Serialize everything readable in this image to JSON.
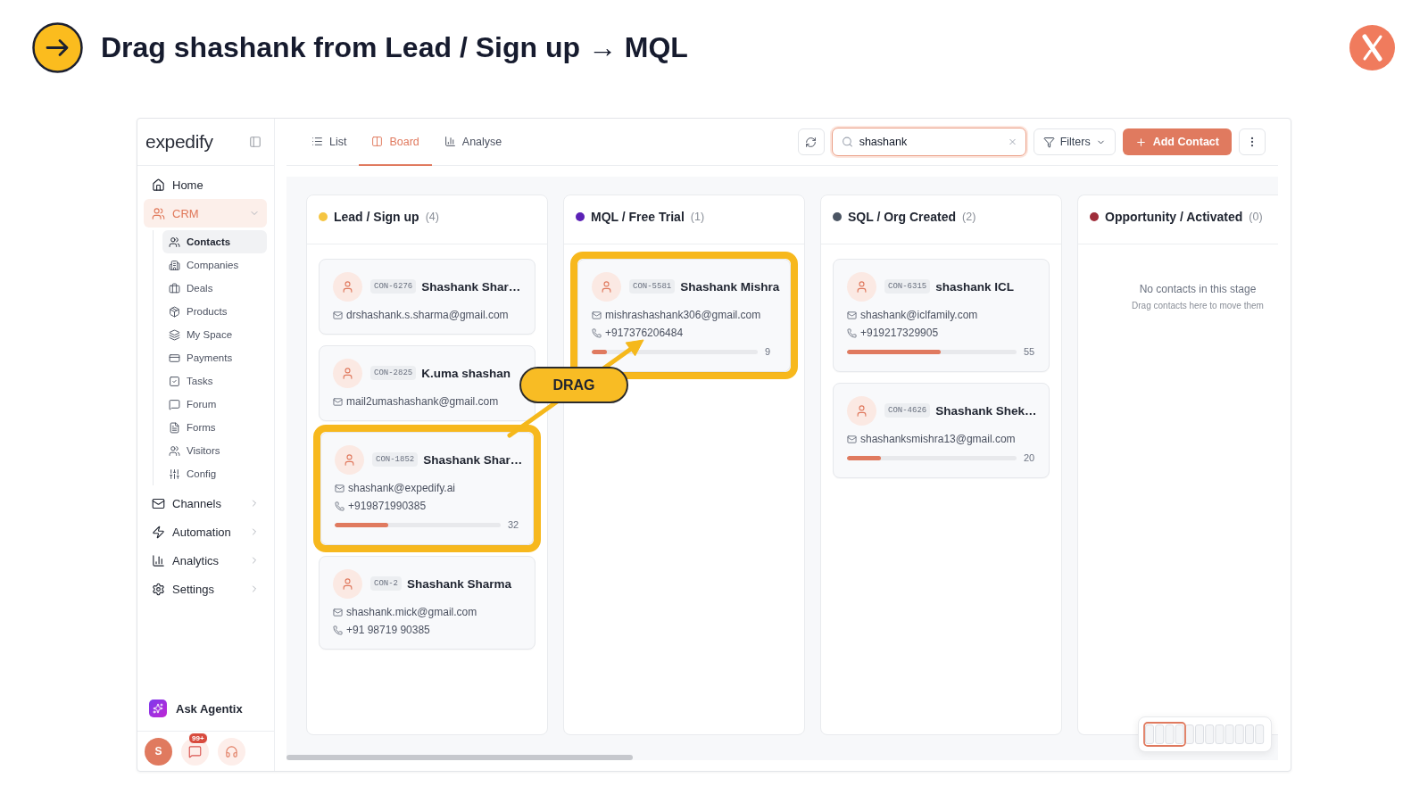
{
  "slide": {
    "title": "Drag shashank from Lead / Sign up → MQL"
  },
  "app": {
    "logo": "expedify",
    "sidebar": {
      "items": [
        {
          "label": "Home",
          "selected": false
        },
        {
          "label": "CRM",
          "selected": true,
          "expanded": true,
          "children": [
            {
              "label": "Contacts",
              "selected": true
            },
            {
              "label": "Companies",
              "selected": false
            },
            {
              "label": "Deals",
              "selected": false
            },
            {
              "label": "Products",
              "selected": false
            },
            {
              "label": "My Space",
              "selected": false
            },
            {
              "label": "Payments",
              "selected": false
            },
            {
              "label": "Tasks",
              "selected": false
            },
            {
              "label": "Forum",
              "selected": false
            },
            {
              "label": "Forms",
              "selected": false
            },
            {
              "label": "Visitors",
              "selected": false
            },
            {
              "label": "Config",
              "selected": false
            }
          ]
        },
        {
          "label": "Channels",
          "selected": false,
          "expanded": false
        },
        {
          "label": "Automation",
          "selected": false,
          "expanded": false
        },
        {
          "label": "Analytics",
          "selected": false,
          "expanded": false
        },
        {
          "label": "Settings",
          "selected": false,
          "expanded": false
        }
      ],
      "assistant": "Ask Agentix",
      "user_initial": "S",
      "notification_count": "99+"
    },
    "view_tabs": [
      {
        "label": "List",
        "selected": false
      },
      {
        "label": "Board",
        "selected": true
      },
      {
        "label": "Analyse",
        "selected": false
      }
    ],
    "search": {
      "value": "shashank"
    },
    "filters_button": "Filters",
    "add_button": "Add Contact",
    "board": {
      "columns": [
        {
          "title": "Lead / Sign up",
          "count": "(4)",
          "color": "#f5c542",
          "cards": [
            {
              "id": "CON-6276",
              "name": "Shashank Shar…",
              "email": "drshashank.s.sharma@gmail.com",
              "highlighted": false
            },
            {
              "id": "CON-2825",
              "name": "K.uma shashan",
              "email": "mail2umashashank@gmail.com",
              "highlighted": false
            },
            {
              "id": "CON-1852",
              "name": "Shashank Shar…",
              "email": "shashank@expedify.ai",
              "phone": "+919871990385",
              "level": 0.32,
              "score": "32",
              "highlighted": true
            },
            {
              "id": "CON-2",
              "name": "Shashank Sharma",
              "email": "shashank.mick@gmail.com",
              "phone": "+91 98719 90385",
              "highlighted": false
            }
          ]
        },
        {
          "title": "MQL / Free Trial",
          "count": "(1)",
          "color": "#5b21b6",
          "cards": [
            {
              "id": "CON-5581",
              "name": "Shashank Mishra",
              "email": "mishrashashank306@gmail.com",
              "phone": "+917376206484",
              "level": 0.09,
              "score": "9",
              "highlighted": true
            }
          ]
        },
        {
          "title": "SQL / Org Created",
          "count": "(2)",
          "color": "#4b5563",
          "cards": [
            {
              "id": "CON-6315",
              "name": "shashank ICL",
              "email": "shashank@iclfamily.com",
              "phone": "+919217329905",
              "level": 0.55,
              "score": "55",
              "highlighted": false
            },
            {
              "id": "CON-4626",
              "name": "Shashank Shek…",
              "email": "shashanksmishra13@gmail.com",
              "level": 0.2,
              "score": "20",
              "highlighted": false
            }
          ]
        },
        {
          "title": "Opportunity / Activated",
          "count": "(0)",
          "color": "#9f2d3a",
          "empty": {
            "title": "No contacts in this stage",
            "hint": "Drag contacts here to move them"
          }
        }
      ]
    }
  },
  "annotation": {
    "label": "DRAG"
  }
}
